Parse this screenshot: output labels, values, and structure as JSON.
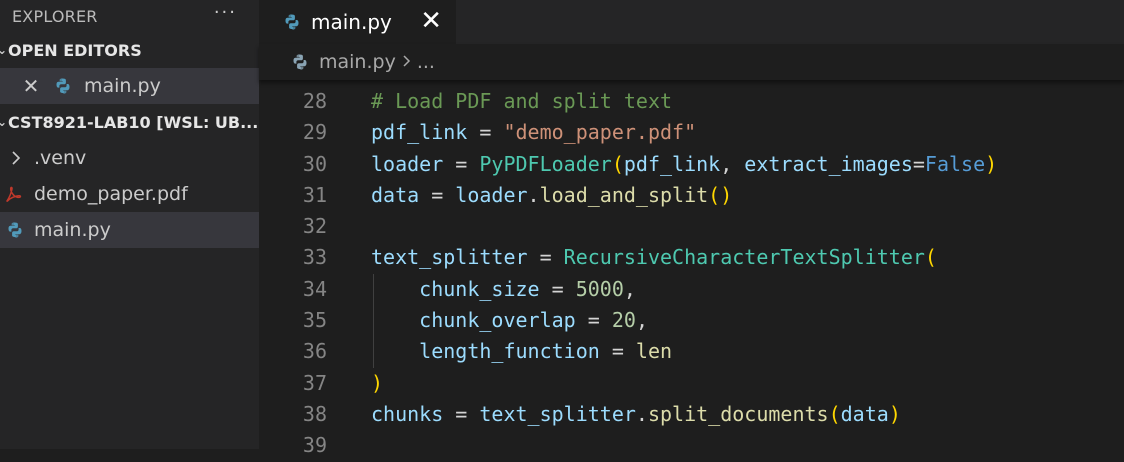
{
  "sidebar": {
    "title": "EXPLORER",
    "more_label": "···",
    "open_editors": {
      "title": "OPEN EDITORS",
      "items": [
        {
          "label": "main.py"
        }
      ]
    },
    "workspace": {
      "title": "CST8921-LAB10 [WSL: UB...",
      "items": [
        {
          "label": ".venv",
          "kind": "folder"
        },
        {
          "label": "demo_paper.pdf",
          "kind": "pdf"
        },
        {
          "label": "main.py",
          "kind": "python"
        }
      ]
    }
  },
  "tabs": [
    {
      "label": "main.py",
      "close": "✕"
    }
  ],
  "breadcrumb": {
    "file": "main.py",
    "ellipsis": "..."
  },
  "colors": {
    "comment": "#6a9955",
    "variable": "#9cdcfe",
    "string": "#ce9178",
    "class": "#4ec9b0",
    "function": "#dcdcaa",
    "keyword": "#569cd6",
    "number": "#b5cea8",
    "bracket": "#ffd700",
    "python_blue": "#519aba",
    "pdf_red": "#c0392b"
  },
  "code": {
    "lines": [
      {
        "num": "28",
        "tokens": [
          {
            "t": "# Load PDF and split text",
            "c": "c-com"
          }
        ]
      },
      {
        "num": "29",
        "tokens": [
          {
            "t": "pdf_link",
            "c": "c-var"
          },
          {
            "t": " = ",
            "c": "c-op"
          },
          {
            "t": "\"demo_paper.pdf\"",
            "c": "c-str"
          }
        ]
      },
      {
        "num": "30",
        "tokens": [
          {
            "t": "loader",
            "c": "c-var"
          },
          {
            "t": " = ",
            "c": "c-op"
          },
          {
            "t": "PyPDFLoader",
            "c": "c-cls"
          },
          {
            "t": "(",
            "c": "c-b1"
          },
          {
            "t": "pdf_link",
            "c": "c-var"
          },
          {
            "t": ", ",
            "c": "c-op"
          },
          {
            "t": "extract_images",
            "c": "c-var"
          },
          {
            "t": "=",
            "c": "c-op"
          },
          {
            "t": "False",
            "c": "c-kw"
          },
          {
            "t": ")",
            "c": "c-b1"
          }
        ]
      },
      {
        "num": "31",
        "tokens": [
          {
            "t": "data",
            "c": "c-var"
          },
          {
            "t": " = ",
            "c": "c-op"
          },
          {
            "t": "loader",
            "c": "c-var"
          },
          {
            "t": ".",
            "c": "c-op"
          },
          {
            "t": "load_and_split",
            "c": "c-fn"
          },
          {
            "t": "()",
            "c": "c-b1"
          }
        ]
      },
      {
        "num": "32",
        "tokens": []
      },
      {
        "num": "33",
        "tokens": [
          {
            "t": "text_splitter",
            "c": "c-var"
          },
          {
            "t": " = ",
            "c": "c-op"
          },
          {
            "t": "RecursiveCharacterTextSplitter",
            "c": "c-cls"
          },
          {
            "t": "(",
            "c": "c-b1"
          }
        ]
      },
      {
        "num": "34",
        "guide": true,
        "tokens": [
          {
            "t": "    ",
            "c": "c-op"
          },
          {
            "t": "chunk_size",
            "c": "c-var"
          },
          {
            "t": " = ",
            "c": "c-op"
          },
          {
            "t": "5000",
            "c": "c-num"
          },
          {
            "t": ",",
            "c": "c-op"
          }
        ]
      },
      {
        "num": "35",
        "guide": true,
        "tokens": [
          {
            "t": "    ",
            "c": "c-op"
          },
          {
            "t": "chunk_overlap",
            "c": "c-var"
          },
          {
            "t": " = ",
            "c": "c-op"
          },
          {
            "t": "20",
            "c": "c-num"
          },
          {
            "t": ",",
            "c": "c-op"
          }
        ]
      },
      {
        "num": "36",
        "guide": true,
        "tokens": [
          {
            "t": "    ",
            "c": "c-op"
          },
          {
            "t": "length_function",
            "c": "c-var"
          },
          {
            "t": " = ",
            "c": "c-op"
          },
          {
            "t": "len",
            "c": "c-fn"
          }
        ]
      },
      {
        "num": "37",
        "tokens": [
          {
            "t": ")",
            "c": "c-b1"
          }
        ]
      },
      {
        "num": "38",
        "tokens": [
          {
            "t": "chunks",
            "c": "c-var"
          },
          {
            "t": " = ",
            "c": "c-op"
          },
          {
            "t": "text_splitter",
            "c": "c-var"
          },
          {
            "t": ".",
            "c": "c-op"
          },
          {
            "t": "split_documents",
            "c": "c-fn"
          },
          {
            "t": "(",
            "c": "c-b1"
          },
          {
            "t": "data",
            "c": "c-var"
          },
          {
            "t": ")",
            "c": "c-b1"
          }
        ]
      },
      {
        "num": "39",
        "tokens": []
      }
    ]
  }
}
